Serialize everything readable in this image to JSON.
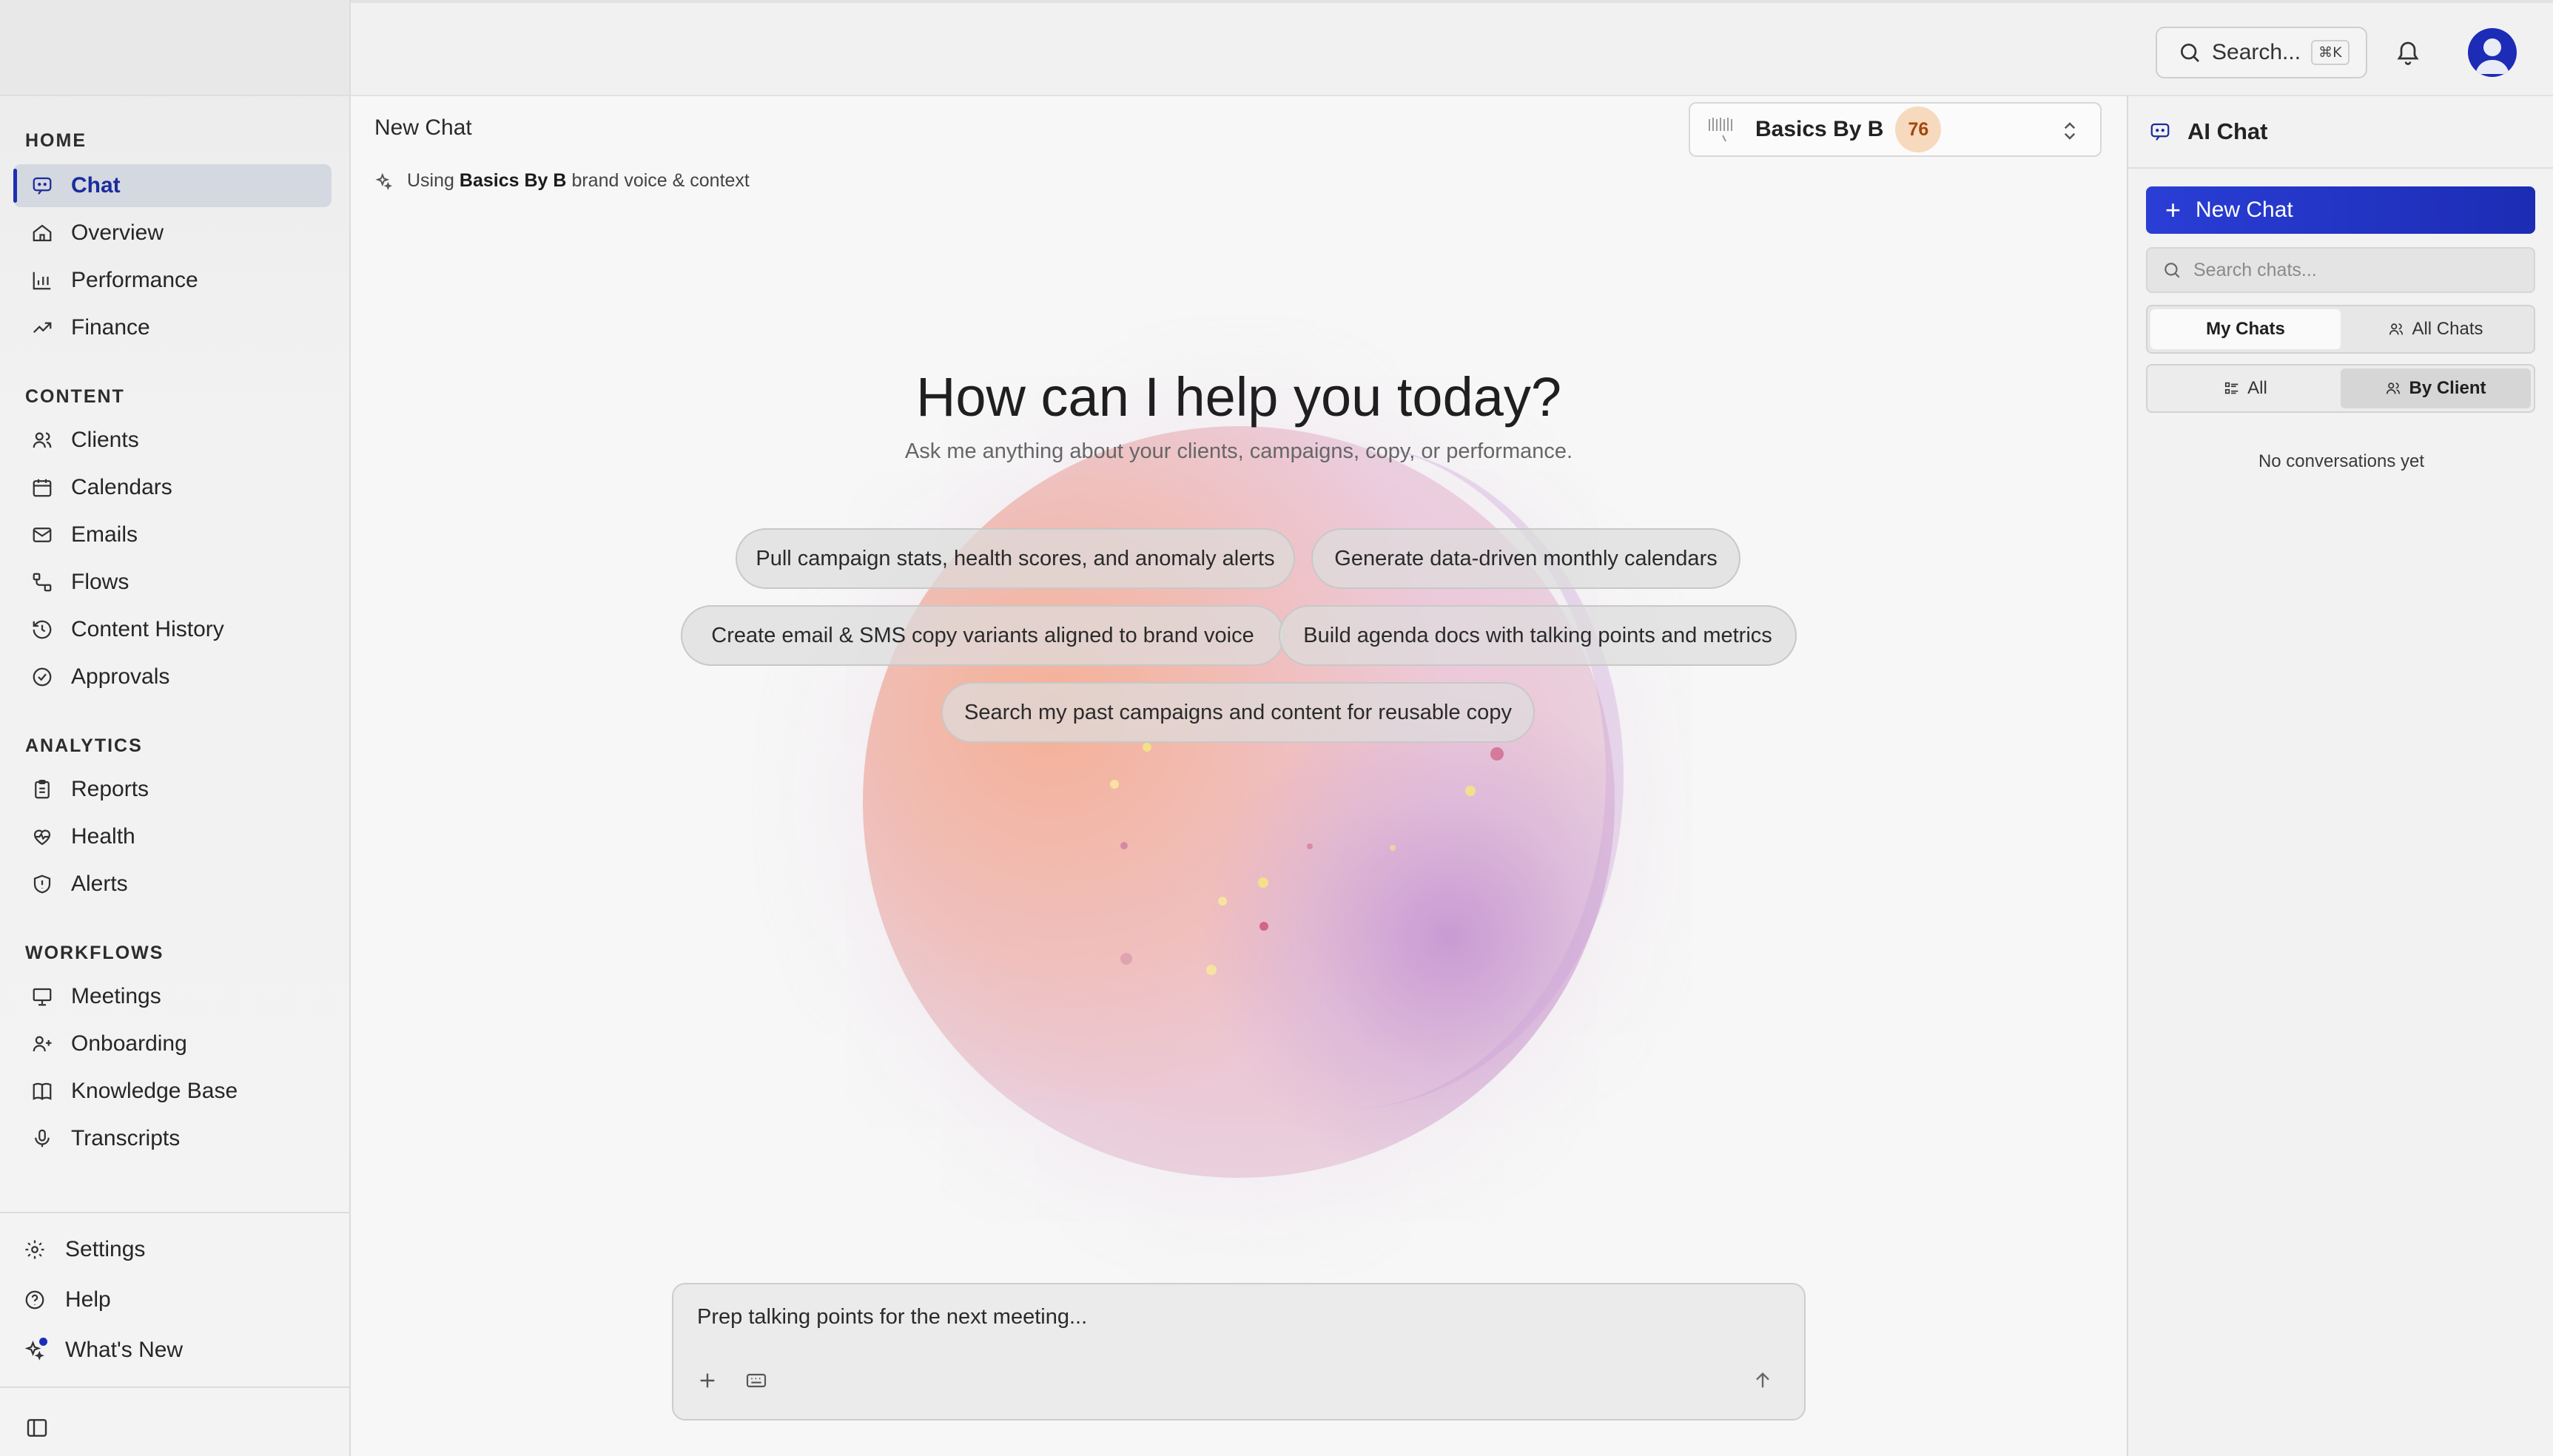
{
  "sidebar": {
    "sections": [
      {
        "label": "HOME",
        "items": [
          {
            "label": "Chat",
            "icon": "chat-icon",
            "active": true
          },
          {
            "label": "Overview",
            "icon": "home-icon"
          },
          {
            "label": "Performance",
            "icon": "bar-chart-icon"
          },
          {
            "label": "Finance",
            "icon": "trending-up-icon"
          }
        ]
      },
      {
        "label": "CONTENT",
        "items": [
          {
            "label": "Clients",
            "icon": "users-icon"
          },
          {
            "label": "Calendars",
            "icon": "calendar-icon"
          },
          {
            "label": "Emails",
            "icon": "mail-icon"
          },
          {
            "label": "Flows",
            "icon": "flow-icon"
          },
          {
            "label": "Content History",
            "icon": "history-icon"
          },
          {
            "label": "Approvals",
            "icon": "check-circle-icon"
          }
        ]
      },
      {
        "label": "ANALYTICS",
        "items": [
          {
            "label": "Reports",
            "icon": "clipboard-icon"
          },
          {
            "label": "Health",
            "icon": "heart-pulse-icon"
          },
          {
            "label": "Alerts",
            "icon": "shield-alert-icon"
          }
        ]
      },
      {
        "label": "WORKFLOWS",
        "items": [
          {
            "label": "Meetings",
            "icon": "presentation-icon"
          },
          {
            "label": "Onboarding",
            "icon": "user-plus-icon"
          },
          {
            "label": "Knowledge Base",
            "icon": "book-icon"
          },
          {
            "label": "Transcripts",
            "icon": "mic-icon"
          }
        ]
      }
    ],
    "utility": [
      {
        "label": "Settings",
        "icon": "gear-icon"
      },
      {
        "label": "Help",
        "icon": "help-circle-icon"
      },
      {
        "label": "What's New",
        "icon": "sparkles-icon"
      }
    ]
  },
  "header": {
    "search_label": "Search...",
    "search_shortcut": "⌘K"
  },
  "main": {
    "title": "New Chat",
    "brand_note": {
      "prefix": "Using",
      "brand": "Basics By B",
      "suffix": "brand voice & context"
    },
    "client": {
      "name": "Basics By B",
      "score": "76"
    },
    "hero_title": "How can I help you today?",
    "hero_subtitle": "Ask me anything about your clients, campaigns, copy, or performance.",
    "suggestions": [
      "Pull campaign stats, health scores, and anomaly alerts",
      "Generate data-driven monthly calendars",
      "Create email & SMS copy variants aligned to brand voice",
      "Build agenda docs with talking points and metrics",
      "Search my past campaigns and content for reusable copy"
    ],
    "composer_text": "Prep talking points for the next meeting..."
  },
  "right_panel": {
    "title": "AI Chat",
    "new_chat_label": "New Chat",
    "search_placeholder": "Search chats...",
    "tabs_owner": [
      "My Chats",
      "All Chats"
    ],
    "tabs_group": [
      "All",
      "By Client"
    ],
    "empty_text": "No conversations yet"
  },
  "colors": {
    "accent": "#1f2fb0",
    "active_nav_bg": "#d4d8e0",
    "score_bg": "#f7d9bd",
    "score_text": "#a0480c"
  }
}
